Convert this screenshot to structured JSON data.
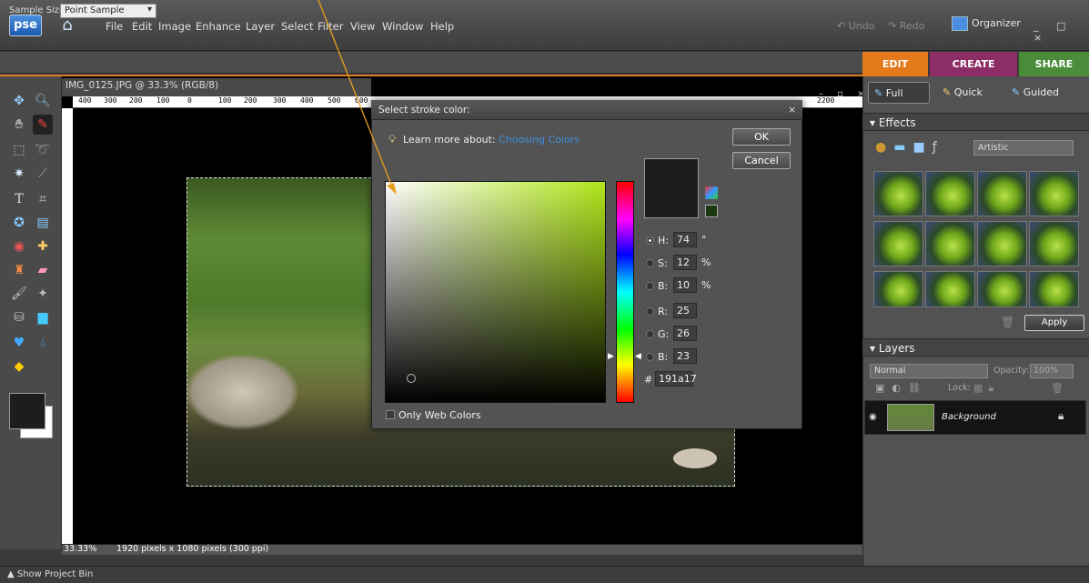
{
  "app": {
    "logo": "pse"
  },
  "menu": [
    "File",
    "Edit",
    "Image",
    "Enhance",
    "Layer",
    "Select",
    "Filter",
    "View",
    "Window",
    "Help"
  ],
  "toolbar": {
    "undo": "Undo",
    "redo": "Redo",
    "organizer": "Organizer",
    "window_controls": "_ □ ×"
  },
  "options": {
    "sample_size_label": "Sample Size:",
    "sample_size_value": "Point Sample"
  },
  "mode_tabs": {
    "edit": "EDIT",
    "create": "CREATE",
    "share": "SHARE"
  },
  "document": {
    "title": "IMG_0125.JPG @ 33.3% (RGB/8)",
    "zoom": "33.33%",
    "size": "1920 pixels x 1080 pixels (300 ppi)",
    "ruler_ticks": [
      "400",
      "300",
      "200",
      "100",
      "0",
      "100",
      "200",
      "300",
      "400",
      "500",
      "600",
      "2200"
    ]
  },
  "project_bin": "▲ Show Project Bin",
  "right_panel": {
    "views": {
      "full": "Full",
      "quick": "Quick",
      "guided": "Guided"
    },
    "effects_title": "Effects",
    "effects_filter": "Artistic",
    "apply": "Apply",
    "layers_title": "Layers",
    "blend_mode": "Normal",
    "opacity_label": "Opacity:",
    "opacity_value": "100%",
    "lock_label": "Lock:",
    "layer_name": "Background"
  },
  "dialog": {
    "title": "Select stroke color:",
    "learn_prefix": "Learn more about:",
    "learn_link": "Choosing Colors",
    "ok": "OK",
    "cancel": "Cancel",
    "channels": [
      {
        "label": "H:",
        "value": "74",
        "unit": "°",
        "selected": true
      },
      {
        "label": "S:",
        "value": "12",
        "unit": "%",
        "selected": false
      },
      {
        "label": "B:",
        "value": "10",
        "unit": "%",
        "selected": false
      },
      {
        "label": "R:",
        "value": "25",
        "unit": "",
        "selected": false
      },
      {
        "label": "G:",
        "value": "26",
        "unit": "",
        "selected": false
      },
      {
        "label": "B:",
        "value": "23",
        "unit": "",
        "selected": false
      }
    ],
    "hex_label": "#",
    "hex_value": "191a17",
    "only_web_colors": "Only Web Colors"
  },
  "colors": {
    "accent_orange": "#e07b1f",
    "current_color": "#191a17",
    "create_tab": "#8c2d66",
    "share_tab": "#4b8c3a"
  }
}
